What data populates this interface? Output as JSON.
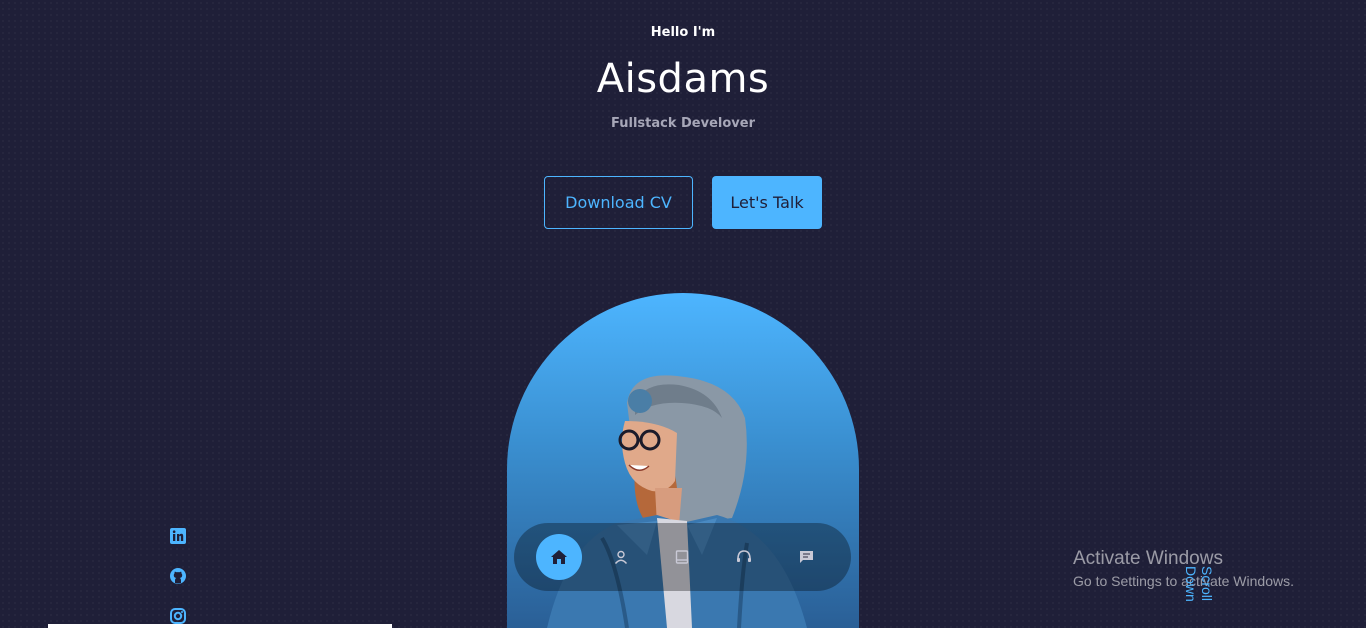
{
  "header": {
    "greeting": "Hello I'm",
    "name": "Aisdams",
    "role": "Fullstack Develover"
  },
  "cta": {
    "download_label": "Download CV",
    "talk_label": "Let's Talk"
  },
  "nav": {
    "items": [
      {
        "icon": "home-icon",
        "active": true
      },
      {
        "icon": "user-icon",
        "active": false
      },
      {
        "icon": "book-icon",
        "active": false
      },
      {
        "icon": "headset-icon",
        "active": false
      },
      {
        "icon": "message-icon",
        "active": false
      }
    ]
  },
  "socials": [
    "linkedin-icon",
    "github-icon",
    "instagram-icon"
  ],
  "scroll_label": "Scroll Down",
  "os_overlay": {
    "title": "Activate Windows",
    "subtitle": "Go to Settings to activate Windows."
  },
  "colors": {
    "background": "#1f1f38",
    "accent": "#4db5ff",
    "muted_text": "#a7a7b8"
  }
}
